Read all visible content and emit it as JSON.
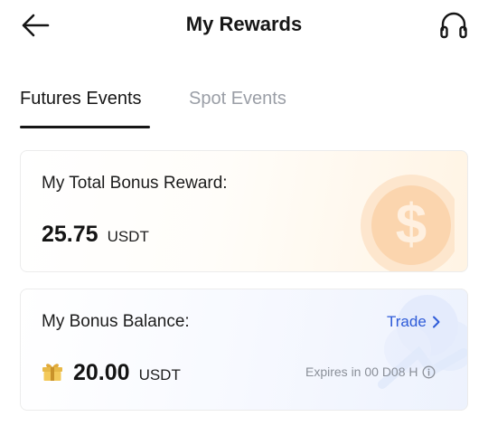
{
  "header": {
    "title": "My Rewards",
    "back_icon": "arrow-left-icon",
    "support_icon": "headset-icon"
  },
  "tabs": [
    {
      "label": "Futures Events",
      "active": true
    },
    {
      "label": "Spot Events",
      "active": false
    }
  ],
  "total_bonus": {
    "label": "My Total Bonus Reward:",
    "amount": "25.75",
    "unit": "USDT",
    "decor_icon": "dollar-coin-icon"
  },
  "bonus_balance": {
    "label": "My Bonus Balance:",
    "amount": "20.00",
    "unit": "USDT",
    "link_label": "Trade",
    "link_icon": "chevron-right-icon",
    "gift_icon": "gift-icon",
    "expiry_text": "Expires in 00 D08 H",
    "info_icon": "info-icon"
  },
  "colors": {
    "accent_link": "#2e5bd8",
    "text_primary": "#161616",
    "text_muted": "#9a9ea6",
    "coin": "#f9b77d"
  }
}
